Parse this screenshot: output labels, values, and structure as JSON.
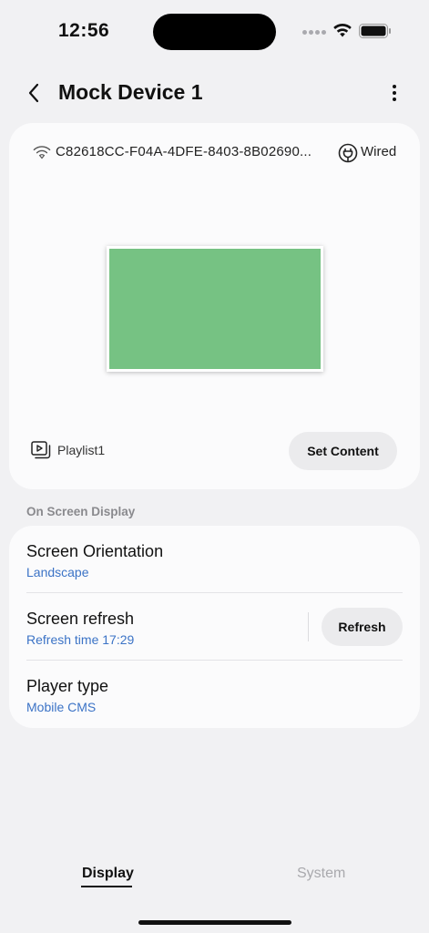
{
  "status_bar": {
    "time": "12:56",
    "icons": [
      "cellular-signal-icon",
      "wifi-icon",
      "battery-icon"
    ]
  },
  "header": {
    "back_icon": "chevron-left-icon",
    "title": "Mock Device 1",
    "more_icon": "more-vertical-icon"
  },
  "device": {
    "connection_icon": "wifi-icon",
    "id": "C82618CC-F04A-4DFE-8403-8B02690...",
    "connection_type_icon": "plug-icon",
    "connection_type": "Wired",
    "preview_color": "#76c283",
    "playlist_icon": "playlist-play-icon",
    "playlist": "Playlist1",
    "set_content_label": "Set Content"
  },
  "section": {
    "title": "On Screen Display"
  },
  "settings": {
    "rows": [
      {
        "title": "Screen Orientation",
        "value": "Landscape"
      },
      {
        "title": "Screen refresh",
        "value": "Refresh time 17:29",
        "action": "Refresh"
      },
      {
        "title": "Player type",
        "value": "Mobile CMS"
      }
    ]
  },
  "tabs": [
    {
      "label": "Display",
      "active": true
    },
    {
      "label": "System",
      "active": false
    }
  ],
  "colors": {
    "accent_link": "#3b73c6",
    "background": "#f1f1f3",
    "card": "#fbfbfc",
    "button": "#ebebed"
  }
}
